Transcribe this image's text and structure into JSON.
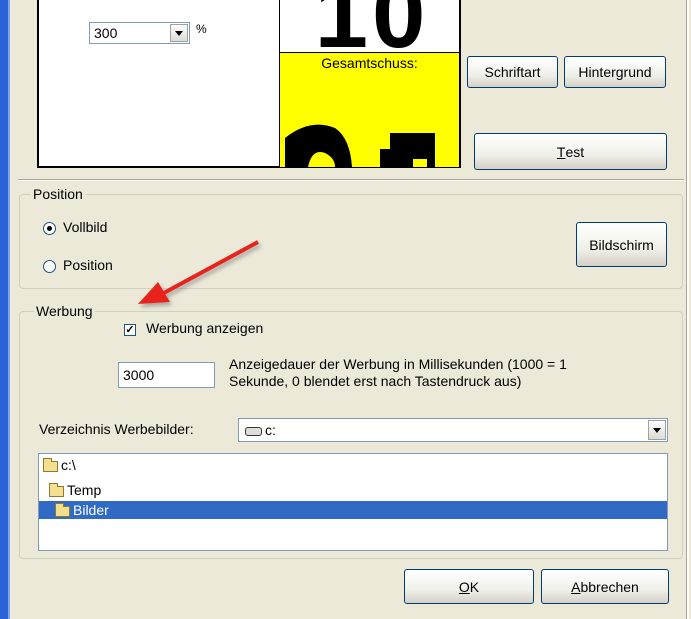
{
  "preview": {
    "size_value": "300",
    "size_unit": "%",
    "big_number": "10",
    "panel_label": "Gesamtschuss:",
    "panel_color": "#ffff00"
  },
  "buttons": {
    "font": "Schriftart",
    "background": "Hintergrund",
    "test_u": "T",
    "test_rest": "est",
    "screen": "Bildschirm",
    "ok_u": "O",
    "ok_rest": "K",
    "cancel_u": "A",
    "cancel_rest": "bbrechen"
  },
  "position": {
    "legend": "Position",
    "opt_fullscreen": "Vollbild",
    "opt_position": "Position",
    "selected": "Vollbild"
  },
  "werbung": {
    "legend": "Werbung",
    "show_label": "Werbung anzeigen",
    "show_checked": true,
    "duration_value": "3000",
    "duration_desc_line1": "Anzeigedauer der Werbung in Millisekunden (1000 = 1",
    "duration_desc_line2": "Sekunde, 0 blendet erst nach Tastendruck aus)",
    "dir_label": "Verzeichnis Werbebilder:",
    "drive_value": "c:",
    "tree": [
      "c:\\",
      "Temp",
      "Bilder"
    ],
    "tree_selected": "Bilder"
  },
  "colors": {
    "selection": "#316ac5",
    "arrow": "#e8231a"
  }
}
